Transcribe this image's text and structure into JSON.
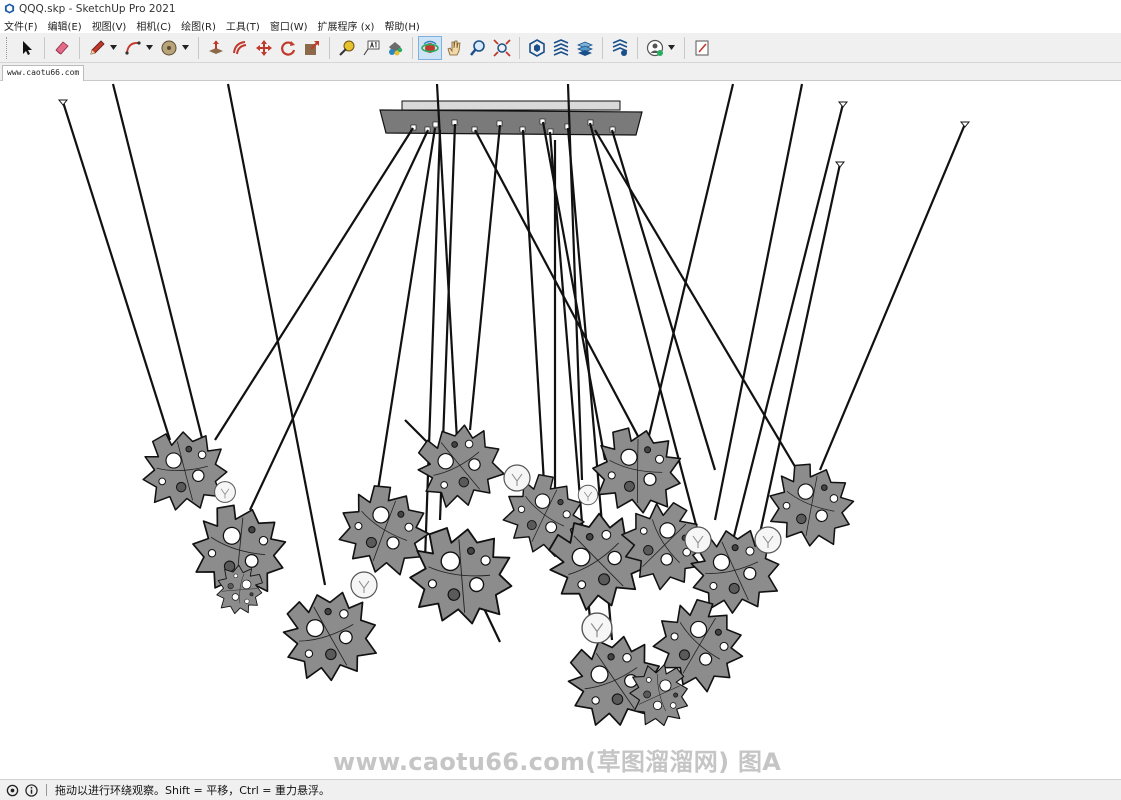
{
  "window": {
    "title": "QQQ.skp - SketchUp Pro 2021"
  },
  "menu": [
    "文件(F)",
    "编辑(E)",
    "视图(V)",
    "相机(C)",
    "绘图(R)",
    "工具(T)",
    "窗口(W)",
    "扩展程序 (x)",
    "帮助(H)"
  ],
  "toolbar": {
    "tools": [
      {
        "name": "select-tool",
        "icon": "select-arrow-icon"
      },
      {
        "name": "eraser-tool",
        "icon": "eraser-icon"
      },
      {
        "name": "line-tool",
        "icon": "pencil-icon",
        "dropdown": true
      },
      {
        "name": "arc-tool",
        "icon": "arc-icon",
        "dropdown": true
      },
      {
        "name": "shape-tool",
        "icon": "circle-icon",
        "dropdown": true
      },
      {
        "name": "push-pull-tool",
        "icon": "push-pull-icon"
      },
      {
        "name": "offset-tool",
        "icon": "offset-icon"
      },
      {
        "name": "move-tool",
        "icon": "move-icon"
      },
      {
        "name": "rotate-tool",
        "icon": "rotate-icon"
      },
      {
        "name": "scale-tool",
        "icon": "scale-icon"
      },
      {
        "name": "tape-measure-tool",
        "icon": "tape-measure-icon"
      },
      {
        "name": "text-tool",
        "icon": "text-icon"
      },
      {
        "name": "paint-bucket-tool",
        "icon": "paint-bucket-icon"
      },
      {
        "name": "orbit-tool",
        "icon": "orbit-icon",
        "active": true
      },
      {
        "name": "pan-tool",
        "icon": "hand-icon"
      },
      {
        "name": "zoom-tool",
        "icon": "zoom-icon"
      },
      {
        "name": "zoom-extents-tool",
        "icon": "zoom-extents-icon"
      },
      {
        "name": "3d-warehouse",
        "icon": "warehouse-icon"
      },
      {
        "name": "extension-warehouse",
        "icon": "extension-warehouse-icon"
      },
      {
        "name": "layout-send",
        "icon": "layout-icon"
      },
      {
        "name": "extension-manager",
        "icon": "extension-manager-icon"
      },
      {
        "name": "account",
        "icon": "user-icon",
        "dropdown": true
      },
      {
        "name": "notes",
        "icon": "notes-icon"
      }
    ]
  },
  "scene_tab": {
    "label": "www.caotu66.com"
  },
  "watermark": "www.caotu66.com(草图溜溜网) 图A",
  "status": {
    "text": "拖动以进行环绕观察。Shift = 平移，Ctrl = 重力悬浮。"
  }
}
